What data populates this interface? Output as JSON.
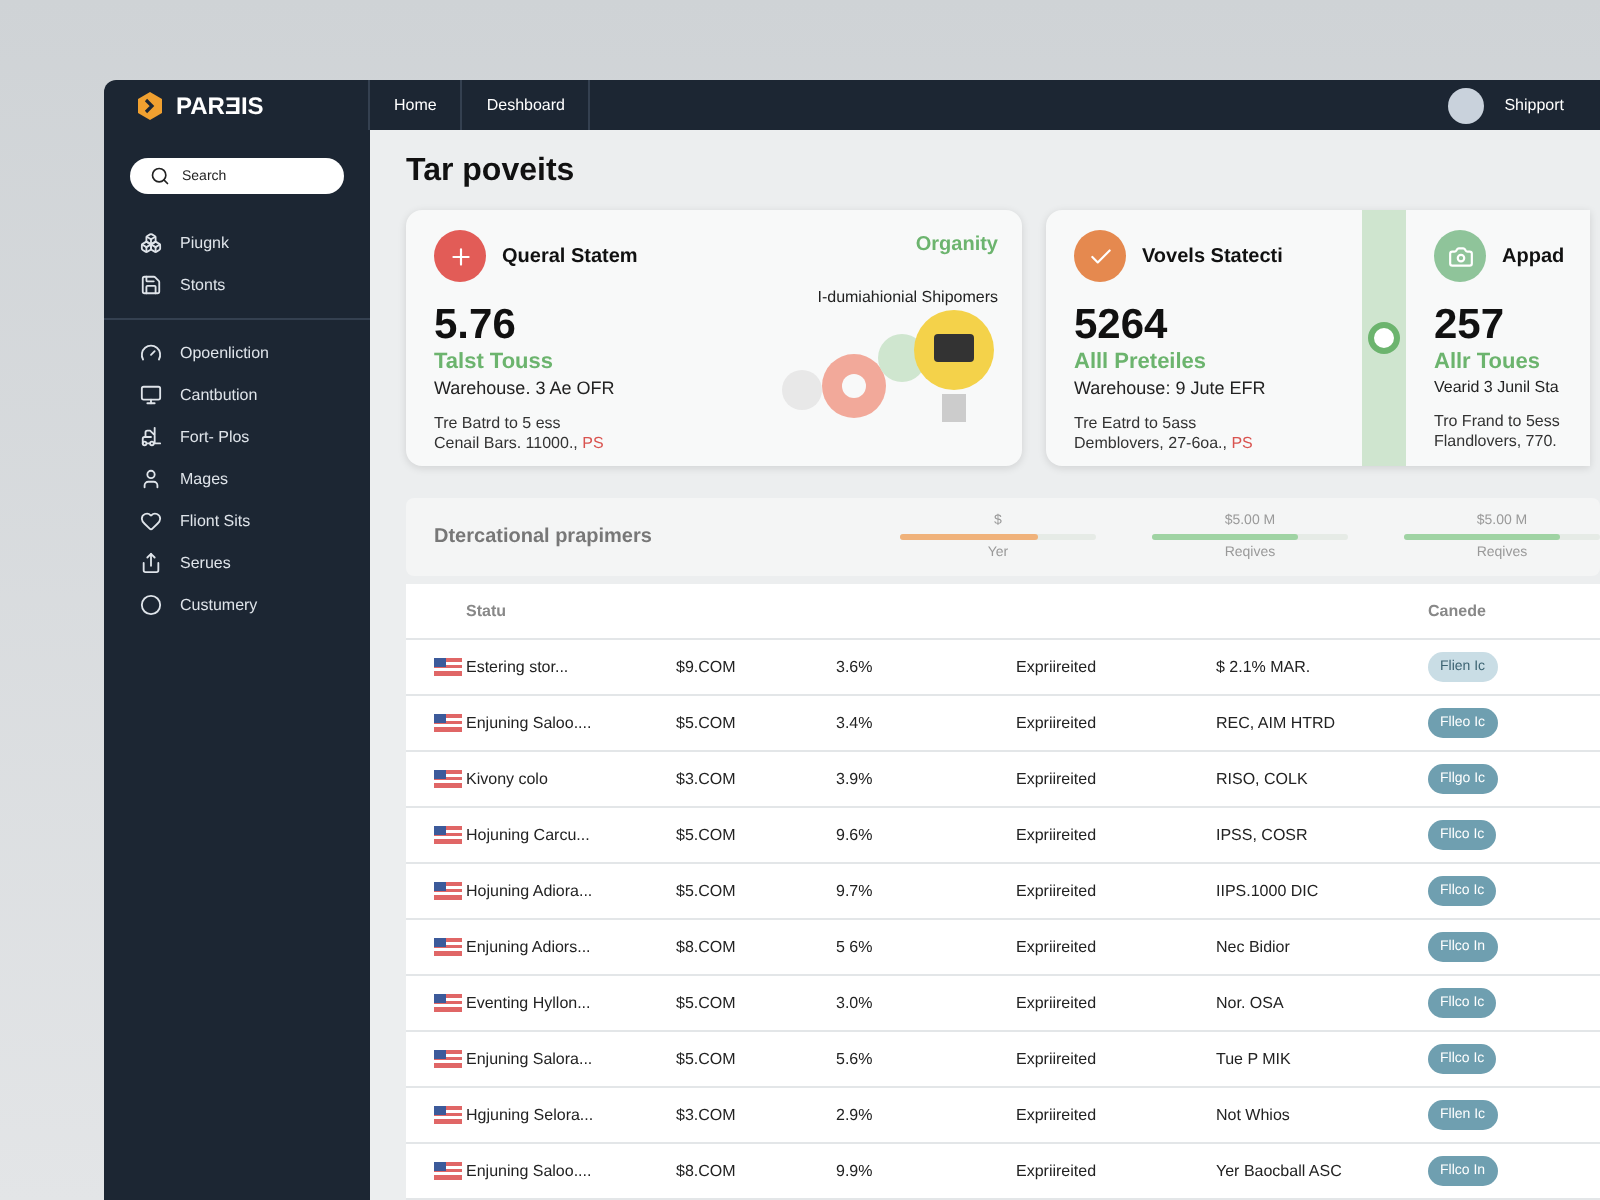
{
  "brand": "PARƎIS",
  "nav": [
    {
      "label": "Home",
      "selected": false
    },
    {
      "label": "Deshboard",
      "selected": false
    }
  ],
  "user": {
    "name": "Shipport"
  },
  "search": {
    "placeholder": "Search"
  },
  "sidebar": {
    "groups": [
      {
        "items": [
          {
            "label": "Piugnk",
            "kind": "boxes"
          },
          {
            "label": "Stonts",
            "kind": "save"
          }
        ]
      },
      {
        "items": [
          {
            "label": "Opoenliction",
            "kind": "gauge"
          },
          {
            "label": "Cantbution",
            "kind": "monitor"
          },
          {
            "label": "Fort- Plos",
            "kind": "forklift"
          },
          {
            "label": "Mages",
            "kind": "user"
          },
          {
            "label": "Fliont Sits",
            "kind": "heart"
          },
          {
            "label": "Serues",
            "kind": "share"
          },
          {
            "label": "Custumery",
            "kind": "circle"
          }
        ]
      }
    ]
  },
  "title": "Tar poveits",
  "card": {
    "kind": "plus",
    "color": "#e25c57",
    "title": "Queral Statem",
    "tag": "Organity",
    "value": "5.76",
    "subtitle": "Talst Touss",
    "line": "Warehouse. 3 Ae OFR",
    "note1": "Tre Batrd to 5 ess",
    "note2": "Cenail Bars. 11000.,",
    "flag": "PS",
    "caption": "I-dumiahionial Shipomers"
  },
  "stats": [
    {
      "kind": "check",
      "color": "#e5894f",
      "title": "Vovels Statecti",
      "value": "5264",
      "subtitle": "Alll Preteiles",
      "line": "Warehouse: 9 Jute EFR",
      "note1": "Tre Eatrd to 5ass",
      "note2": "Demblovers, 27-6oa.,",
      "flag": "PS"
    },
    {
      "kind": "camera",
      "color": "#8fc49a",
      "title": "Appad",
      "value": "257",
      "subtitle": "Allr Toues",
      "line": "Vearid 3 Junil Sta",
      "note1": "Tro Frand to 5ess",
      "note2": "Flandlovers, 770."
    }
  ],
  "summary": {
    "title": "Dtercational prapimers",
    "meters": [
      {
        "top": "$",
        "bottom": "Yer",
        "level": 0.7,
        "color": "#f0b27a"
      },
      {
        "top": "$5.00 M",
        "bottom": "Reqives",
        "level": 0.75,
        "color": "#9fd3a3"
      },
      {
        "top": "$5.00 M",
        "bottom": "Reqives",
        "level": 0.8,
        "color": "#9fd3a3"
      }
    ]
  },
  "table": {
    "columns": [
      "Statu",
      "",
      "",
      "",
      "",
      "Canede"
    ],
    "rows": [
      {
        "name": "Estering stor...",
        "amount": "$9.COM",
        "pct": "3.6%",
        "status": "Expriireited",
        "detail": "$ 2.1% MAR.",
        "action": "Flien Ic",
        "active": false
      },
      {
        "name": "Enjuning Saloo....",
        "amount": "$5.COM",
        "pct": "3.4%",
        "status": "Expriireited",
        "detail": "REC, AIM HTRD",
        "action": "Flleo Ic",
        "active": true
      },
      {
        "name": "Kivony colo",
        "amount": "$3.COM",
        "pct": "3.9%",
        "status": "Expriireited",
        "detail": "RISO, COLK",
        "action": "Fllgo Ic",
        "active": true
      },
      {
        "name": "Hojuning Carcu...",
        "amount": "$5.COM",
        "pct": "9.6%",
        "status": "Expriireited",
        "detail": "IPSS, COSR",
        "action": "Fllco Ic",
        "active": true
      },
      {
        "name": "Hojuning Adiora...",
        "amount": "$5.COM",
        "pct": "9.7%",
        "status": "Expriireited",
        "detail": "IIPS.1000 DIC",
        "action": "Fllco Ic",
        "active": true
      },
      {
        "name": "Enjuning Adiors...",
        "amount": "$8.COM",
        "pct": "5 6%",
        "status": "Expriireited",
        "detail": "Nec Bidior",
        "action": "Fllco In",
        "active": true
      },
      {
        "name": "Eventing Hyllon...",
        "amount": "$5.COM",
        "pct": "3.0%",
        "status": "Expriireited",
        "detail": "Nor. OSA",
        "action": "Fllco Ic",
        "active": true
      },
      {
        "name": "Enjuning Salora...",
        "amount": "$5.COM",
        "pct": "5.6%",
        "status": "Expriireited",
        "detail": "Tue P MIK",
        "action": "Fllco Ic",
        "active": true
      },
      {
        "name": "Hgjuning Selora...",
        "amount": "$3.COM",
        "pct": "2.9%",
        "status": "Expriireited",
        "detail": "Not Whios",
        "action": "Fllen Ic",
        "active": true
      },
      {
        "name": "Enjuning Saloo....",
        "amount": "$8.COM",
        "pct": "9.9%",
        "status": "Expriireited",
        "detail": "Yer Baocball ASC",
        "action": "Fllco In",
        "active": true
      }
    ]
  }
}
